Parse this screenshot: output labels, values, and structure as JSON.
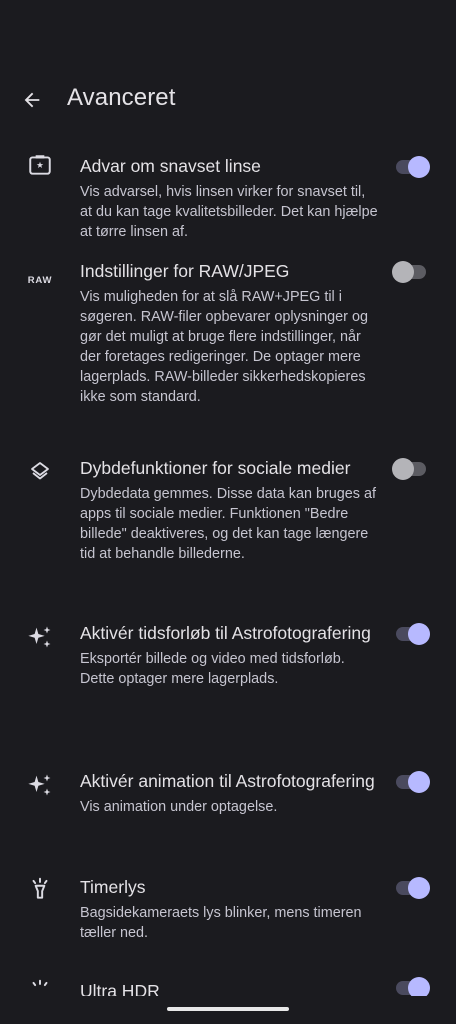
{
  "header": {
    "title": "Avanceret",
    "back_icon": "arrow-back-icon"
  },
  "settings": [
    {
      "icon": "lens-warning-icon",
      "title": "Advar om snavset linse",
      "desc": "Vis advarsel, hvis linsen virker for snavset til, at du kan tage kvalitetsbilleder. Det kan hjælpe at tørre linsen af.",
      "enabled": true
    },
    {
      "icon": "raw-icon",
      "icon_text": "RAW",
      "title": "Indstillinger for RAW/JPEG",
      "desc": "Vis muligheden for at slå RAW+JPEG til i søgeren. RAW-filer opbevarer oplysninger og gør det muligt at bruge flere indstillinger, når der foretages redigeringer. De optager mere lagerplads. RAW-billeder sikkerhedskopieres ikke som standard.",
      "enabled": false
    },
    {
      "icon": "layers-icon",
      "title": "Dybdefunktioner for sociale medier",
      "desc": "Dybdedata gemmes. Disse data kan bruges af apps til sociale medier. Funktionen \"Bedre billede\" deaktiveres, og det kan tage længere tid at behandle billederne.",
      "enabled": false
    },
    {
      "icon": "sparkle-icon",
      "title": "Aktivér tidsforløb til Astrofotografering",
      "desc": "Eksportér billede og video med tidsforløb. Dette optager mere lagerplads.",
      "enabled": true
    },
    {
      "icon": "sparkle-icon",
      "title": "Aktivér animation til Astrofotografering",
      "desc": "Vis animation under optagelse.",
      "enabled": true
    },
    {
      "icon": "timer-light-icon",
      "title": "Timerlys",
      "desc": "Bagsidekameraets lys blinker, mens timeren tæller ned.",
      "enabled": true
    },
    {
      "icon": "ultra-hdr-icon",
      "title": "Ultra HDR",
      "enabled": true
    }
  ],
  "colors": {
    "background": "#1b1b1f",
    "toggle_on_thumb": "#b7b9ff",
    "toggle_on_track": "#4a4a5e",
    "toggle_off_thumb": "#b4b4b8"
  }
}
